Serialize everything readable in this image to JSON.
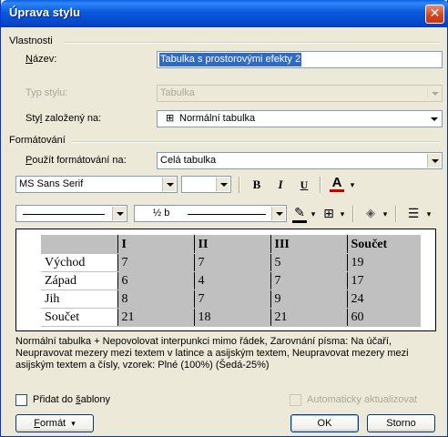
{
  "window": {
    "title": "Úprava stylu",
    "close_glyph": "✕"
  },
  "properties": {
    "group_label": "Vlastnosti",
    "name_label_pre": "",
    "name_label_u": "N",
    "name_label_post": "ázev:",
    "name_value": "Tabulka s prostorovými efekty 2",
    "style_type_label": "Typ stylu:",
    "style_type_value": "Tabulka",
    "based_on_label_pre": "Sty",
    "based_on_label_u": "l",
    "based_on_label_post": " založený na:",
    "based_on_icon_glyph": "⊞",
    "based_on_value": "Normální tabulka"
  },
  "formatting": {
    "group_label": "Formátování",
    "apply_to_label_pre": "",
    "apply_to_label_u": "P",
    "apply_to_label_post": "oužít formátování na:",
    "apply_to_value": "Celá tabulka",
    "font_value": "MS Sans Serif",
    "size_value": "",
    "bold": "B",
    "italic": "I",
    "underline": "U",
    "font_color_glyph": "A",
    "font_color": "#cc0000",
    "dropdown_glyph": "▾",
    "line_weight_value": "½ b",
    "pen_glyph": "✎",
    "pen_color": "#000000",
    "borders_glyph": "⊞",
    "shading_glyph": "◈",
    "align_glyph": "☰"
  },
  "preview": {
    "header": [
      "",
      "I",
      "II",
      "III",
      "Součet"
    ],
    "rows": [
      [
        "Východ",
        "7",
        "7",
        "5",
        "19"
      ],
      [
        "Západ",
        "6",
        "4",
        "7",
        "17"
      ],
      [
        "Jih",
        "8",
        "7",
        "9",
        "24"
      ],
      [
        "Součet",
        "21",
        "18",
        "21",
        "60"
      ]
    ]
  },
  "description": "Normální tabulka + Nepovolovat interpunkci mimo řádek, Zarovnání písma: Na účaří, Neupravovat mezery mezi textem v latince a asijským textem, Neupravovat mezery mezi asijským textem a čísly, vzorek: Plné (100%) (Šedá-25%)",
  "footer": {
    "add_template_pre": "Přidat do ",
    "add_template_u": "š",
    "add_template_post": "ablony",
    "auto_update": "Automaticky aktualizovat",
    "format_u": "F",
    "format_post": "ormát",
    "format_arrow": "▾",
    "ok": "OK",
    "cancel": "Storno"
  },
  "colors": {
    "title_bar": "#0a58de",
    "dialog_bg": "#ece9d8",
    "selection": "#316ac5",
    "table_shade": "#c0c0c0"
  }
}
